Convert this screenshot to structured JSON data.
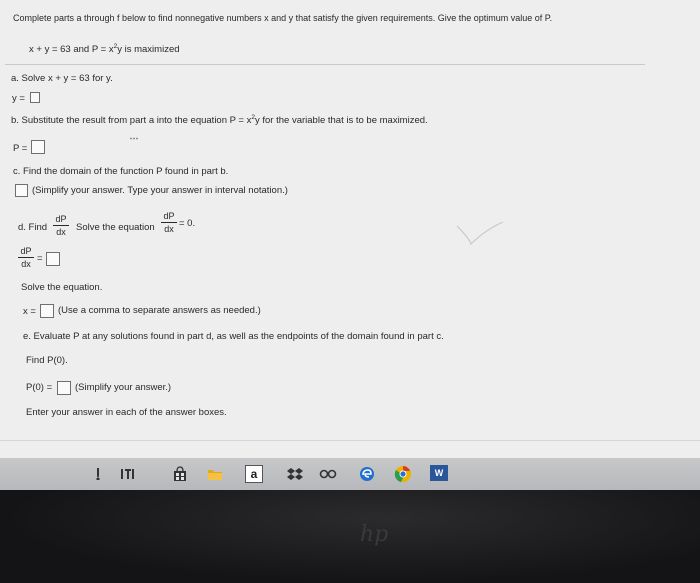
{
  "intro": "Complete parts a through f below to find nonnegative numbers x and y that satisfy the given requirements. Give the optimum value of P.",
  "constraint_pre": "x + y = 63 and P = x",
  "constraint_exp": "2",
  "constraint_post": "y is maximized",
  "part_a": {
    "prompt": "a. Solve x + y = 63 for y.",
    "answer_label": "y ="
  },
  "part_b": {
    "prompt_pre": "b. Substitute the result from part a into the equation P = x",
    "prompt_exp": "2",
    "prompt_post": "y for the variable that is to be maximized.",
    "answer_label": "P ="
  },
  "part_c": {
    "prompt": "c. Find the domain of the function P found in part b.",
    "note": "(Simplify your answer. Type your answer in interval notation.)"
  },
  "part_d": {
    "find_label": "d. Find",
    "solve_label": "Solve the equation",
    "frac_num": "dP",
    "frac_den": "dx",
    "eq_rhs": "= 0.",
    "deriv_eq": "=",
    "solve_prompt": "Solve the equation.",
    "x_label": "x =",
    "x_note": "(Use a comma to separate answers as needed.)"
  },
  "part_e": {
    "prompt": "e. Evaluate P at any solutions found in part d, as well as the endpoints of the domain found in part c.",
    "find_p0": "Find P(0).",
    "p0_label": "P(0) =",
    "p0_note": "(Simplify your answer.)"
  },
  "footer": "Enter your answer in each of the answer boxes.",
  "taskbar": {
    "icons": [
      "pen-icon",
      "language-icon",
      "store-icon",
      "file-explorer-icon",
      "amazon-icon",
      "dropbox-icon",
      "link-icon",
      "edge-icon",
      "chrome-icon",
      "word-icon"
    ],
    "amazon_glyph": "a",
    "word_glyph": "W"
  },
  "bezel": {
    "brand": "hp"
  },
  "colors": {
    "page": "#eeeeef",
    "taskbar": "#bfc0c3",
    "bezel": "#1b1b1d",
    "edge": "#1f6fd1",
    "chrome": "#e8b400",
    "word": "#2b579a"
  }
}
